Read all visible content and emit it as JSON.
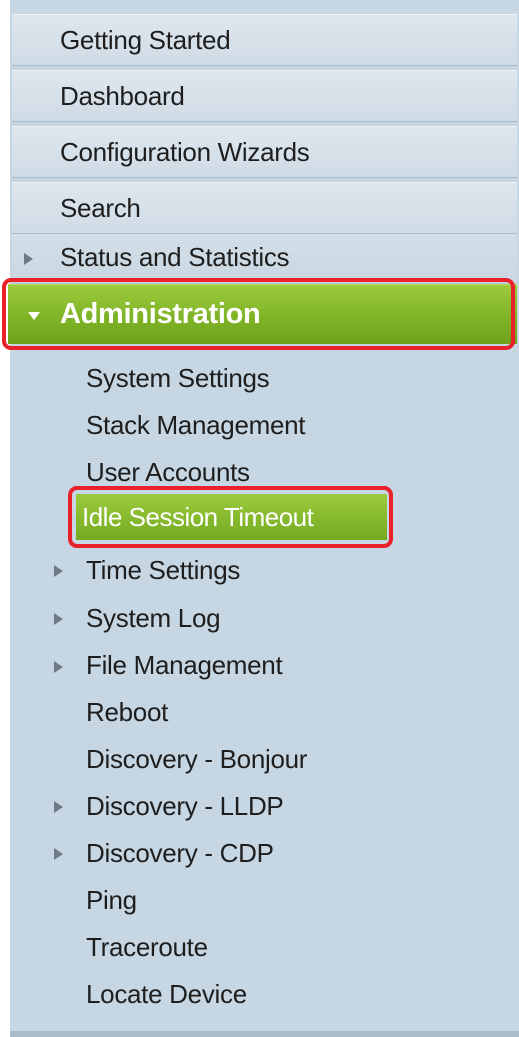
{
  "nav": {
    "top_items": [
      {
        "label": "Getting Started"
      },
      {
        "label": "Dashboard"
      },
      {
        "label": "Configuration Wizards"
      },
      {
        "label": "Search"
      }
    ],
    "status_and_statistics": {
      "label": "Status and Statistics",
      "icon": "triangle-right-icon"
    },
    "administration": {
      "label": "Administration",
      "icon": "triangle-down-icon",
      "accent_color": "#7fb427",
      "highlight_color": "#e8212b",
      "items": [
        {
          "label": "System Settings",
          "expandable": false
        },
        {
          "label": "Stack Management",
          "expandable": false
        },
        {
          "label": "User Accounts",
          "expandable": false
        },
        {
          "label": "Idle Session Timeout",
          "expandable": false,
          "selected": true
        },
        {
          "label": "Time Settings",
          "expandable": true
        },
        {
          "label": "System Log",
          "expandable": true
        },
        {
          "label": "File Management",
          "expandable": true
        },
        {
          "label": "Reboot",
          "expandable": false
        },
        {
          "label": "Discovery - Bonjour",
          "expandable": false
        },
        {
          "label": "Discovery - LLDP",
          "expandable": true
        },
        {
          "label": "Discovery - CDP",
          "expandable": true
        },
        {
          "label": "Ping",
          "expandable": false
        },
        {
          "label": "Traceroute",
          "expandable": false
        },
        {
          "label": "Locate Device",
          "expandable": false
        }
      ]
    }
  }
}
